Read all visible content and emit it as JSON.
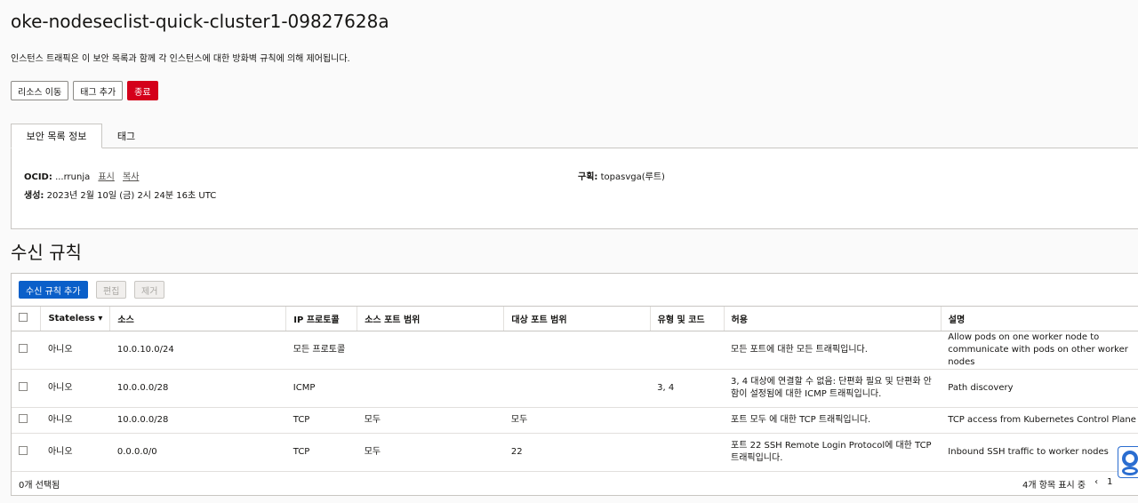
{
  "header": {
    "title": "oke-nodeseclist-quick-cluster1-09827628a",
    "description": "인스턴스 트래픽은 이 보안 목록과 함께 각 인스턴스에 대한 방화벽 규칙에 의해 제어됩니다."
  },
  "actions": {
    "move_resource": "리소스 이동",
    "add_tags": "태그 추가",
    "terminate": "종료"
  },
  "tabs": [
    {
      "label": "보안 목록 정보",
      "active": true
    },
    {
      "label": "태그",
      "active": false
    }
  ],
  "info": {
    "ocid_label": "OCID:",
    "ocid_value": "...rrunja",
    "show_link": "표시",
    "copy_link": "복사",
    "created_label": "생성:",
    "created_value": "2023년 2월 10일 (금) 2시 24분 16초 UTC",
    "compartment_label": "구획:",
    "compartment_value": "topasvga(루트)"
  },
  "ingress": {
    "title": "수신 규칙",
    "add_button": "수신 규칙 추가",
    "edit_button": "편집",
    "remove_button": "제거",
    "columns": [
      "Stateless",
      "소스",
      "IP 프로토콜",
      "소스 포트 범위",
      "대상 포트 범위",
      "유형 및 코드",
      "허용",
      "설명"
    ],
    "rows": [
      {
        "stateless": "아니오",
        "source": "10.0.10.0/24",
        "protocol": "모든 프로토콜",
        "src_ports": "",
        "dst_ports": "",
        "type_code": "",
        "allows": "모든 포트에 대한 모든 트래픽입니다.",
        "description": "Allow pods on one worker node to communicate with pods on other worker nodes"
      },
      {
        "stateless": "아니오",
        "source": "10.0.0.0/28",
        "protocol": "ICMP",
        "src_ports": "",
        "dst_ports": "",
        "type_code": "3, 4",
        "allows": "3, 4 대상에 연결할 수 없음: 단편화 필요 및 단편화 안 함이 설정됨에 대한 ICMP 트래픽입니다.",
        "description": "Path discovery"
      },
      {
        "stateless": "아니오",
        "source": "10.0.0.0/28",
        "protocol": "TCP",
        "src_ports": "모두",
        "dst_ports": "모두",
        "type_code": "",
        "allows": "포트 모두 에 대한 TCP 트래픽입니다.",
        "description": "TCP access from Kubernetes Control Plane"
      },
      {
        "stateless": "아니오",
        "source": "0.0.0.0/0",
        "protocol": "TCP",
        "src_ports": "모두",
        "dst_ports": "22",
        "type_code": "",
        "allows": "포트 22 SSH Remote Login Protocol에 대한 TCP 트래픽입니다.",
        "description": "Inbound SSH traffic to worker nodes"
      }
    ],
    "selected_count": "0개 선택됨",
    "showing": "4개 항목 표시 중",
    "page": "1"
  },
  "colors": {
    "danger": "#d4001a",
    "primary": "#0a5fc9",
    "help": "#2a6dd0"
  }
}
